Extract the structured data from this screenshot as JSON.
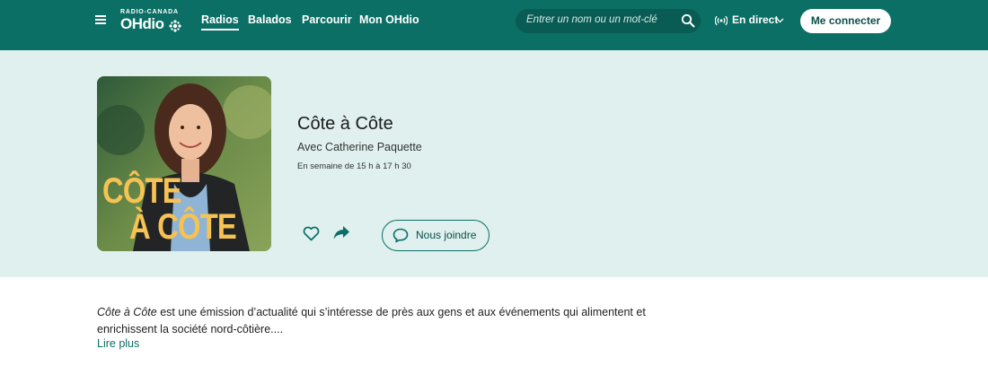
{
  "header": {
    "logo_top": "RADIO-CANADA",
    "logo_main": "OHdio",
    "nav": [
      "Radios",
      "Balados",
      "Parcourir",
      "Mon OHdio"
    ],
    "search_placeholder": "Entrer un nom ou un mot-clé",
    "live_label": "En direct",
    "login_label": "Me connecter",
    "colors": {
      "bar": "#0b6f65",
      "hero": "#dff0ee",
      "accent": "#f5c253"
    }
  },
  "show": {
    "cover_line1": "CÔTE",
    "cover_line2": "À CÔTE",
    "title": "Côte à Côte",
    "host": "Avec Catherine Paquette",
    "schedule": "En semaine de 15 h à 17 h 30",
    "contact_label": "Nous joindre"
  },
  "description": {
    "title_italic": "Côte à Côte",
    "text": " est une émission d’actualité qui s’intéresse de près aux gens et aux événements qui alimentent et enrichissent la société nord-côtière....",
    "more_label": "Lire plus"
  },
  "icons": [
    "menu-icon",
    "cbc-gem-icon",
    "search-icon",
    "radio-waves-icon",
    "chevron-down-icon",
    "heart-icon",
    "share-arrow-icon",
    "chat-bubble-icon"
  ]
}
